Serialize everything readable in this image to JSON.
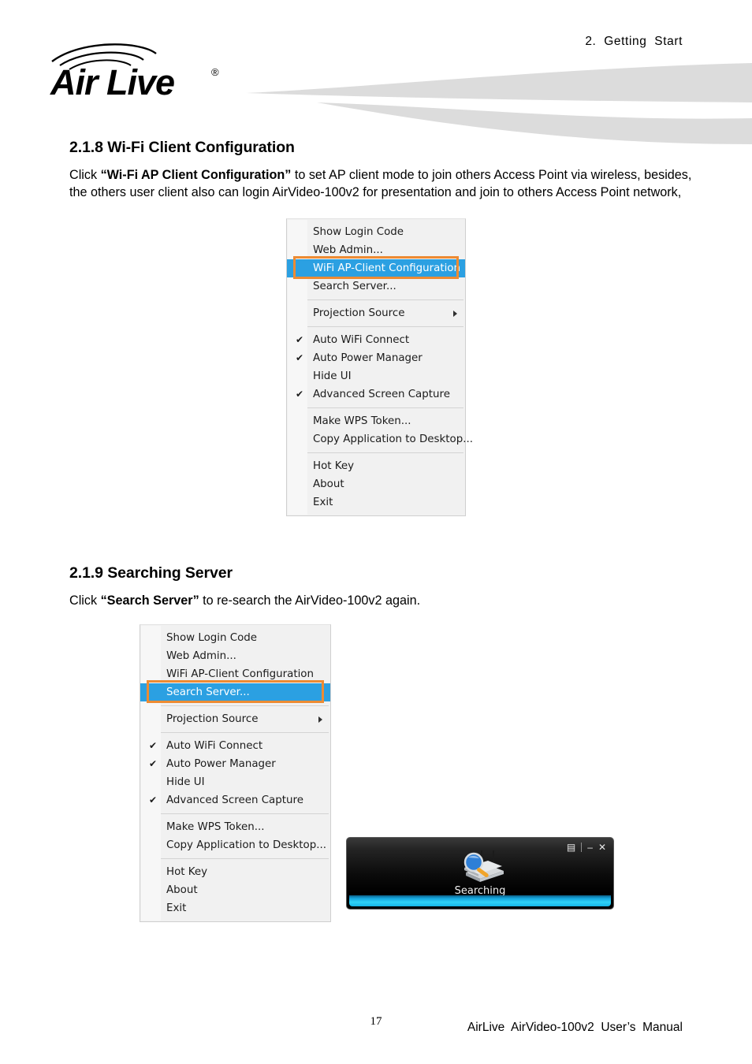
{
  "header": {
    "chapter": "2.  Getting  Start",
    "logo_text": "Air Live",
    "logo_mark": "®"
  },
  "section_1": {
    "heading": "2.1.8 Wi-Fi Client Configuration",
    "para_lead": "Click ",
    "para_bold": "“Wi-Fi AP Client Configuration”",
    "para_rest": " to set AP client mode to join others Access Point via wireless, besides, the others user client also can login AirVideo-100v2 for presentation and join to others Access Point network,"
  },
  "section_2": {
    "heading": "2.1.9 Searching Server",
    "para_lead": "Click ",
    "para_bold": "“Search Server”",
    "para_rest": " to re-search the AirVideo-100v2 again."
  },
  "menu": {
    "items": [
      {
        "label": "Show Login Code",
        "checked": false,
        "submenu": false
      },
      {
        "label": "Web Admin...",
        "checked": false,
        "submenu": false
      },
      {
        "label": "WiFi AP-Client Configuration",
        "checked": false,
        "submenu": false
      },
      {
        "label": "Search Server...",
        "checked": false,
        "submenu": false
      },
      {
        "separator": true
      },
      {
        "label": "Projection Source",
        "checked": false,
        "submenu": true
      },
      {
        "separator": true
      },
      {
        "label": "Auto WiFi Connect",
        "checked": true,
        "submenu": false
      },
      {
        "label": "Auto Power Manager",
        "checked": true,
        "submenu": false
      },
      {
        "label": "Hide UI",
        "checked": false,
        "submenu": false
      },
      {
        "label": "Advanced Screen Capture",
        "checked": true,
        "submenu": false
      },
      {
        "separator": true
      },
      {
        "label": "Make WPS Token...",
        "checked": false,
        "submenu": false
      },
      {
        "label": "Copy Application to Desktop...",
        "checked": false,
        "submenu": false
      },
      {
        "separator": true
      },
      {
        "label": "Hot Key",
        "checked": false,
        "submenu": false
      },
      {
        "label": "About",
        "checked": false,
        "submenu": false
      },
      {
        "label": "Exit",
        "checked": false,
        "submenu": false
      }
    ],
    "check_glyph": "✔",
    "menu_1_selected": "WiFi AP-Client Configuration",
    "menu_2_selected": "Search Server..."
  },
  "dialog": {
    "caption": "Searching",
    "controls": {
      "panel": "▤",
      "minimize": "–",
      "close": "✕"
    }
  },
  "footer": {
    "page_number": "17",
    "manual": "AirLive  AirVideo-100v2  User’s  Manual"
  },
  "colors": {
    "highlight_blue": "#2ba0e2",
    "annotation_orange": "#ed8b33",
    "menu_bg": "#f1f1f1",
    "swoosh_gray": "#dcdcdc",
    "dialog_accent": "#2fd2f7"
  }
}
